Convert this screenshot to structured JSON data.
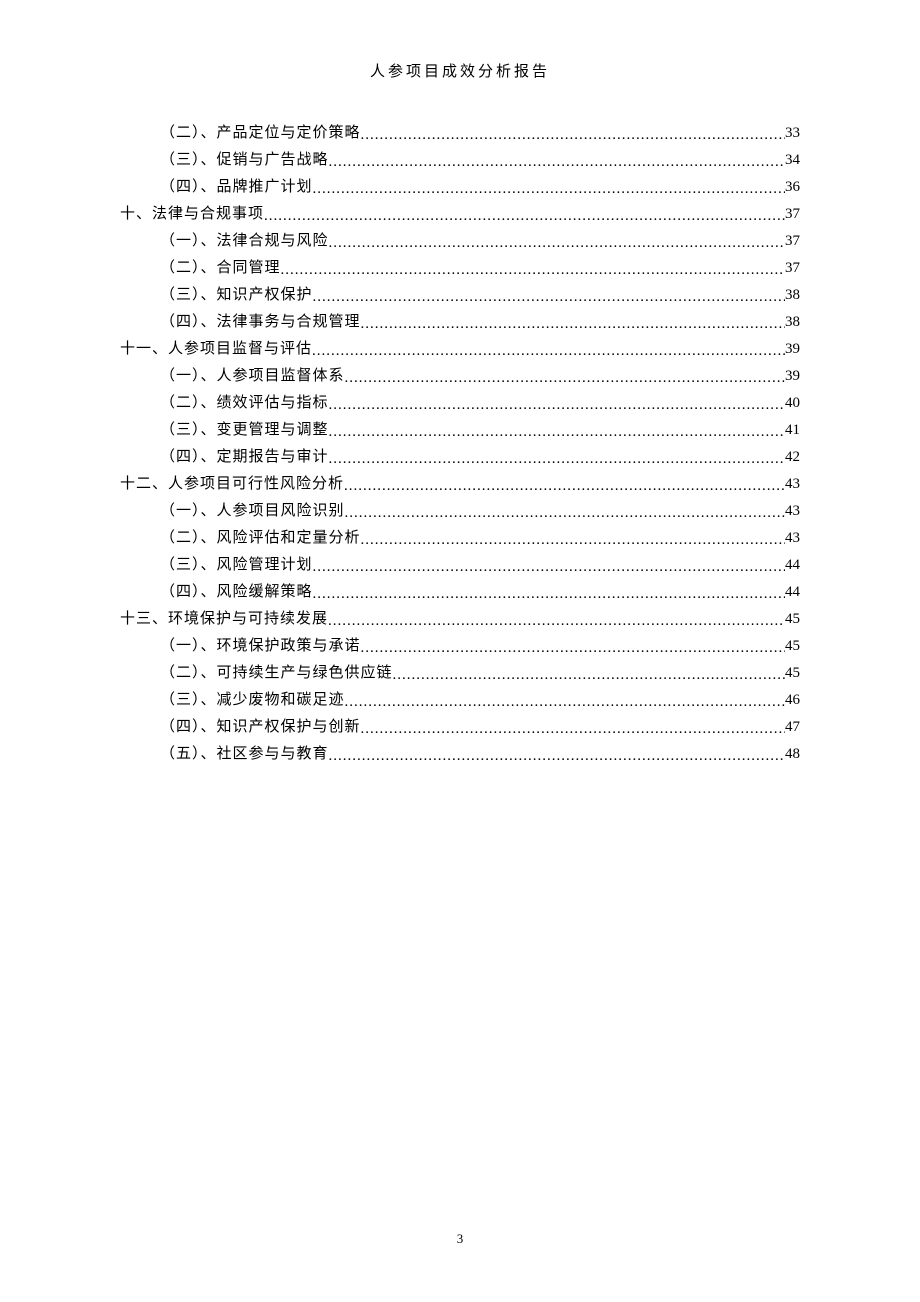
{
  "header": {
    "title": "人参项目成效分析报告"
  },
  "toc": {
    "entries": [
      {
        "level": 2,
        "label": "（二）、产品定位与定价策略",
        "page": "33"
      },
      {
        "level": 2,
        "label": "（三）、促销与广告战略",
        "page": "34"
      },
      {
        "level": 2,
        "label": "（四）、品牌推广计划",
        "page": "36"
      },
      {
        "level": 1,
        "label": "十、法律与合规事项",
        "page": "37"
      },
      {
        "level": 2,
        "label": "（一）、法律合规与风险",
        "page": "37"
      },
      {
        "level": 2,
        "label": "（二）、合同管理",
        "page": "37"
      },
      {
        "level": 2,
        "label": "（三）、知识产权保护",
        "page": "38"
      },
      {
        "level": 2,
        "label": "（四）、法律事务与合规管理",
        "page": "38"
      },
      {
        "level": 1,
        "label": "十一、人参项目监督与评估",
        "page": "39"
      },
      {
        "level": 2,
        "label": "（一）、人参项目监督体系",
        "page": "39"
      },
      {
        "level": 2,
        "label": "（二）、绩效评估与指标",
        "page": "40"
      },
      {
        "level": 2,
        "label": "（三）、变更管理与调整",
        "page": "41"
      },
      {
        "level": 2,
        "label": "（四）、定期报告与审计",
        "page": "42"
      },
      {
        "level": 1,
        "label": "十二、人参项目可行性风险分析",
        "page": "43"
      },
      {
        "level": 2,
        "label": "（一）、人参项目风险识别",
        "page": "43"
      },
      {
        "level": 2,
        "label": "（二）、风险评估和定量分析",
        "page": "43"
      },
      {
        "level": 2,
        "label": "（三）、风险管理计划",
        "page": "44"
      },
      {
        "level": 2,
        "label": "（四）、风险缓解策略",
        "page": "44"
      },
      {
        "level": 1,
        "label": "十三、环境保护与可持续发展",
        "page": "45"
      },
      {
        "level": 2,
        "label": "（一）、环境保护政策与承诺",
        "page": "45"
      },
      {
        "level": 2,
        "label": "（二）、可持续生产与绿色供应链",
        "page": "45"
      },
      {
        "level": 2,
        "label": "（三）、减少废物和碳足迹",
        "page": "46"
      },
      {
        "level": 2,
        "label": "（四）、知识产权保护与创新",
        "page": "47"
      },
      {
        "level": 2,
        "label": "（五）、社区参与与教育",
        "page": "48"
      }
    ]
  },
  "footer": {
    "page_number": "3"
  }
}
